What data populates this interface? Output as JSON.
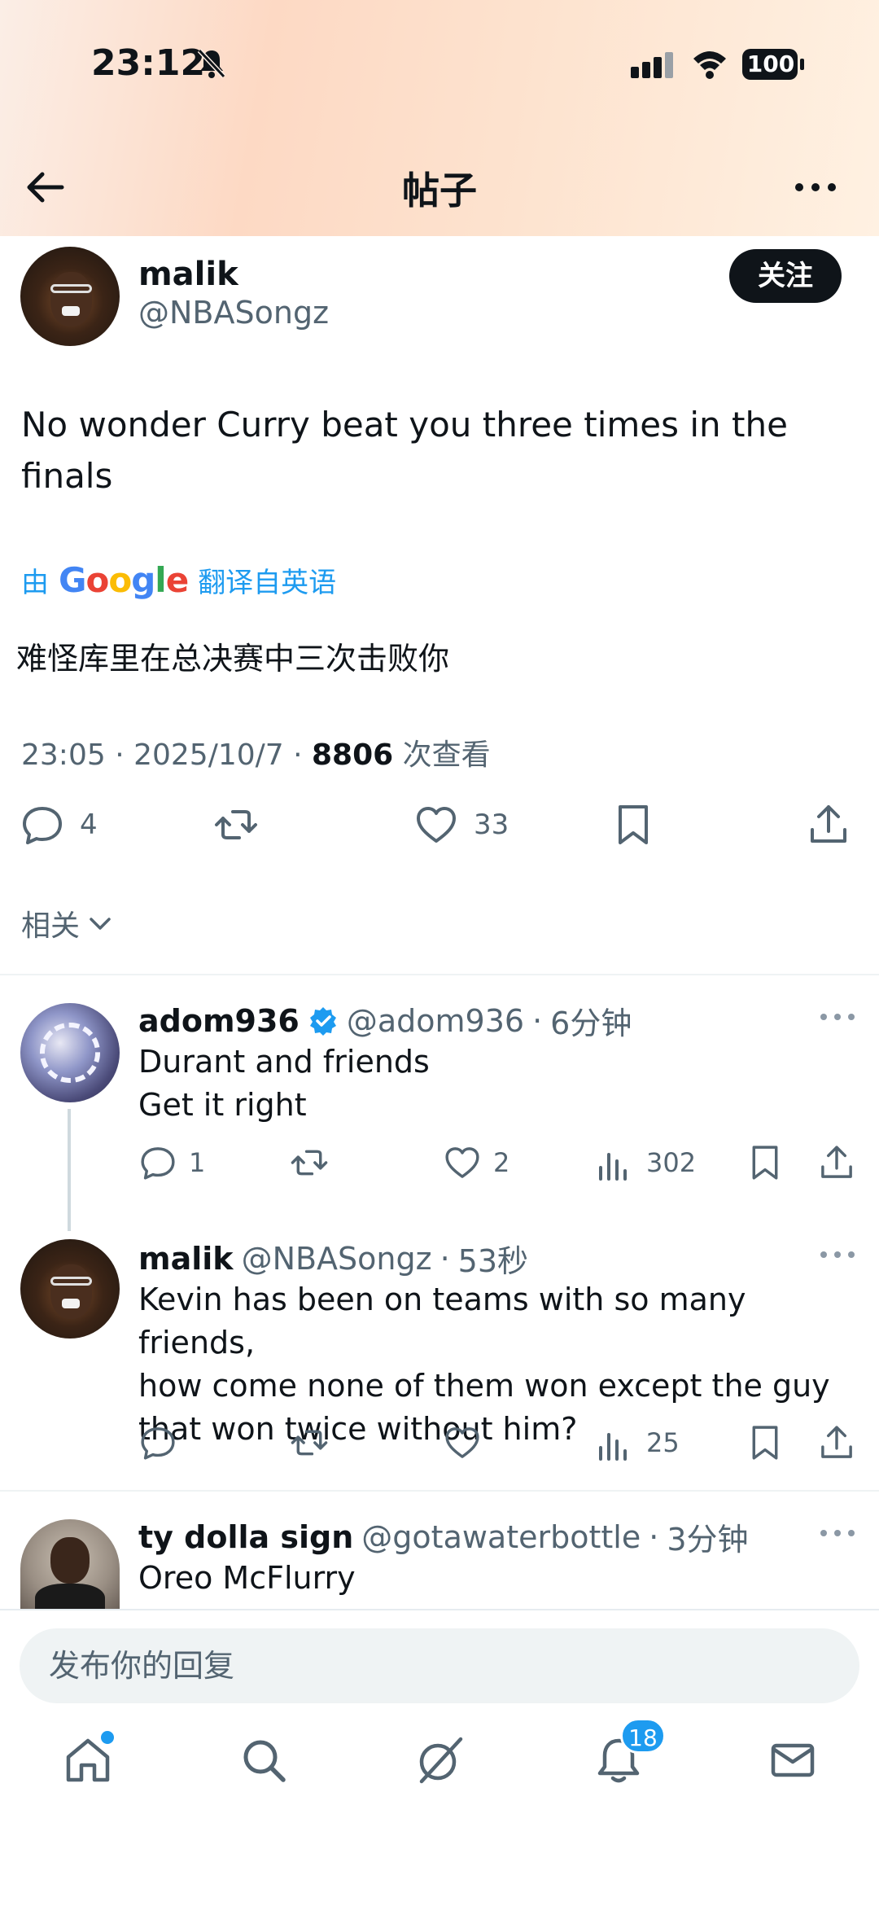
{
  "status_bar": {
    "time": "23:12",
    "battery": "100"
  },
  "nav": {
    "title": "帖子"
  },
  "post": {
    "author_name": "malik",
    "author_handle": "@NBASongz",
    "follow_label": "关注",
    "text": "No wonder Curry beat you three times in the finals",
    "translate_prefix": "由",
    "translate_suffix": "翻译自英语",
    "translated_text": "难怪库里在总决赛中三次击败你",
    "timestamp": "23:05 · 2025/10/7 · ",
    "views_count": "8806",
    "views_label": " 次查看",
    "replies": "4",
    "likes": "33",
    "related_label": "相关"
  },
  "replies": [
    {
      "name": "adom936",
      "handle": "@adom936",
      "time": "6分钟",
      "verified": true,
      "lines": [
        "Durant and friends",
        "Get it right"
      ],
      "replies": "1",
      "likes": "2",
      "views": "302"
    },
    {
      "name": "malik",
      "handle": "@NBASongz",
      "time": "53秒",
      "verified": false,
      "lines": [
        "Kevin has been on teams with so many friends,",
        "how come none of them won except the guy",
        "that won twice without him?"
      ],
      "replies": "",
      "likes": "",
      "views": "25"
    },
    {
      "name": "ty dolla sign",
      "handle": "@gotawaterbottle",
      "time": "3分钟",
      "verified": false,
      "lines": [
        "Oreo McFlurry"
      ]
    }
  ],
  "reply_box": {
    "placeholder": "发布你的回复"
  },
  "bottom_nav": {
    "notifications_badge": "18"
  },
  "colors": {
    "accent": "#1d9bf0",
    "text": "#0f1419",
    "secondary": "#536471"
  }
}
